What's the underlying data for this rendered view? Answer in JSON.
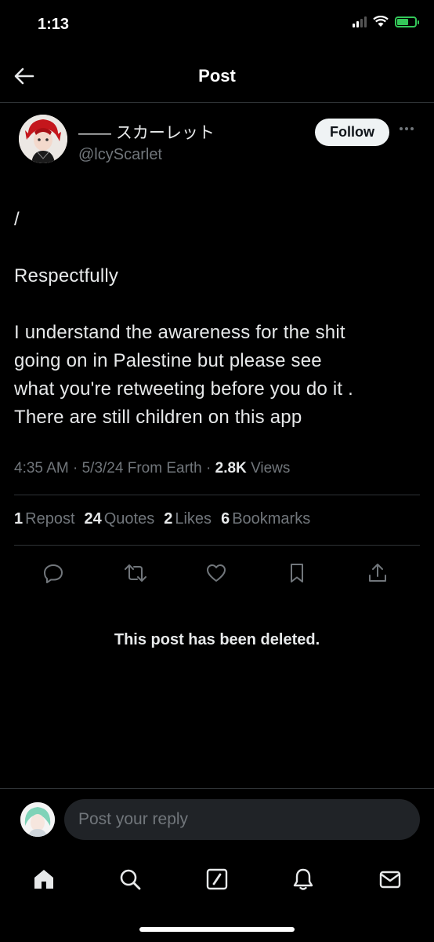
{
  "status_bar": {
    "time": "1:13"
  },
  "header": {
    "title": "Post"
  },
  "author": {
    "display_name": "—— スカーレット",
    "handle": "@lcyScarlet",
    "follow_label": "Follow"
  },
  "post": {
    "lines": [
      "/",
      "",
      "Respectfully",
      "",
      "I understand the awareness for the shit",
      "going on in Palestine but please see",
      "what you're retweeting before you do it .",
      "There are still children on this app"
    ],
    "time": "4:35 AM",
    "date": "5/3/24",
    "source": "From Earth",
    "views_count": "2.8K",
    "views_label": "Views"
  },
  "stats": {
    "reposts_count": "1",
    "reposts_label": "Repost",
    "quotes_count": "24",
    "quotes_label": "Quotes",
    "likes_count": "2",
    "likes_label": "Likes",
    "bookmarks_count": "6",
    "bookmarks_label": "Bookmarks"
  },
  "deleted_notice": "This post has been deleted.",
  "reply": {
    "placeholder": "Post your reply"
  },
  "icons": {
    "back": "back-arrow-icon",
    "more": "more-icon",
    "reply": "reply-icon",
    "repost": "repost-icon",
    "like": "heart-icon",
    "bookmark": "bookmark-icon",
    "share": "share-icon",
    "tabs": [
      "home-icon",
      "search-icon",
      "compose-icon",
      "bell-icon",
      "mail-icon"
    ]
  },
  "colors": {
    "background": "#000000",
    "text": "#e7e9ea",
    "muted": "#71767b",
    "divider": "#2f3336",
    "battery": "#34c759"
  }
}
